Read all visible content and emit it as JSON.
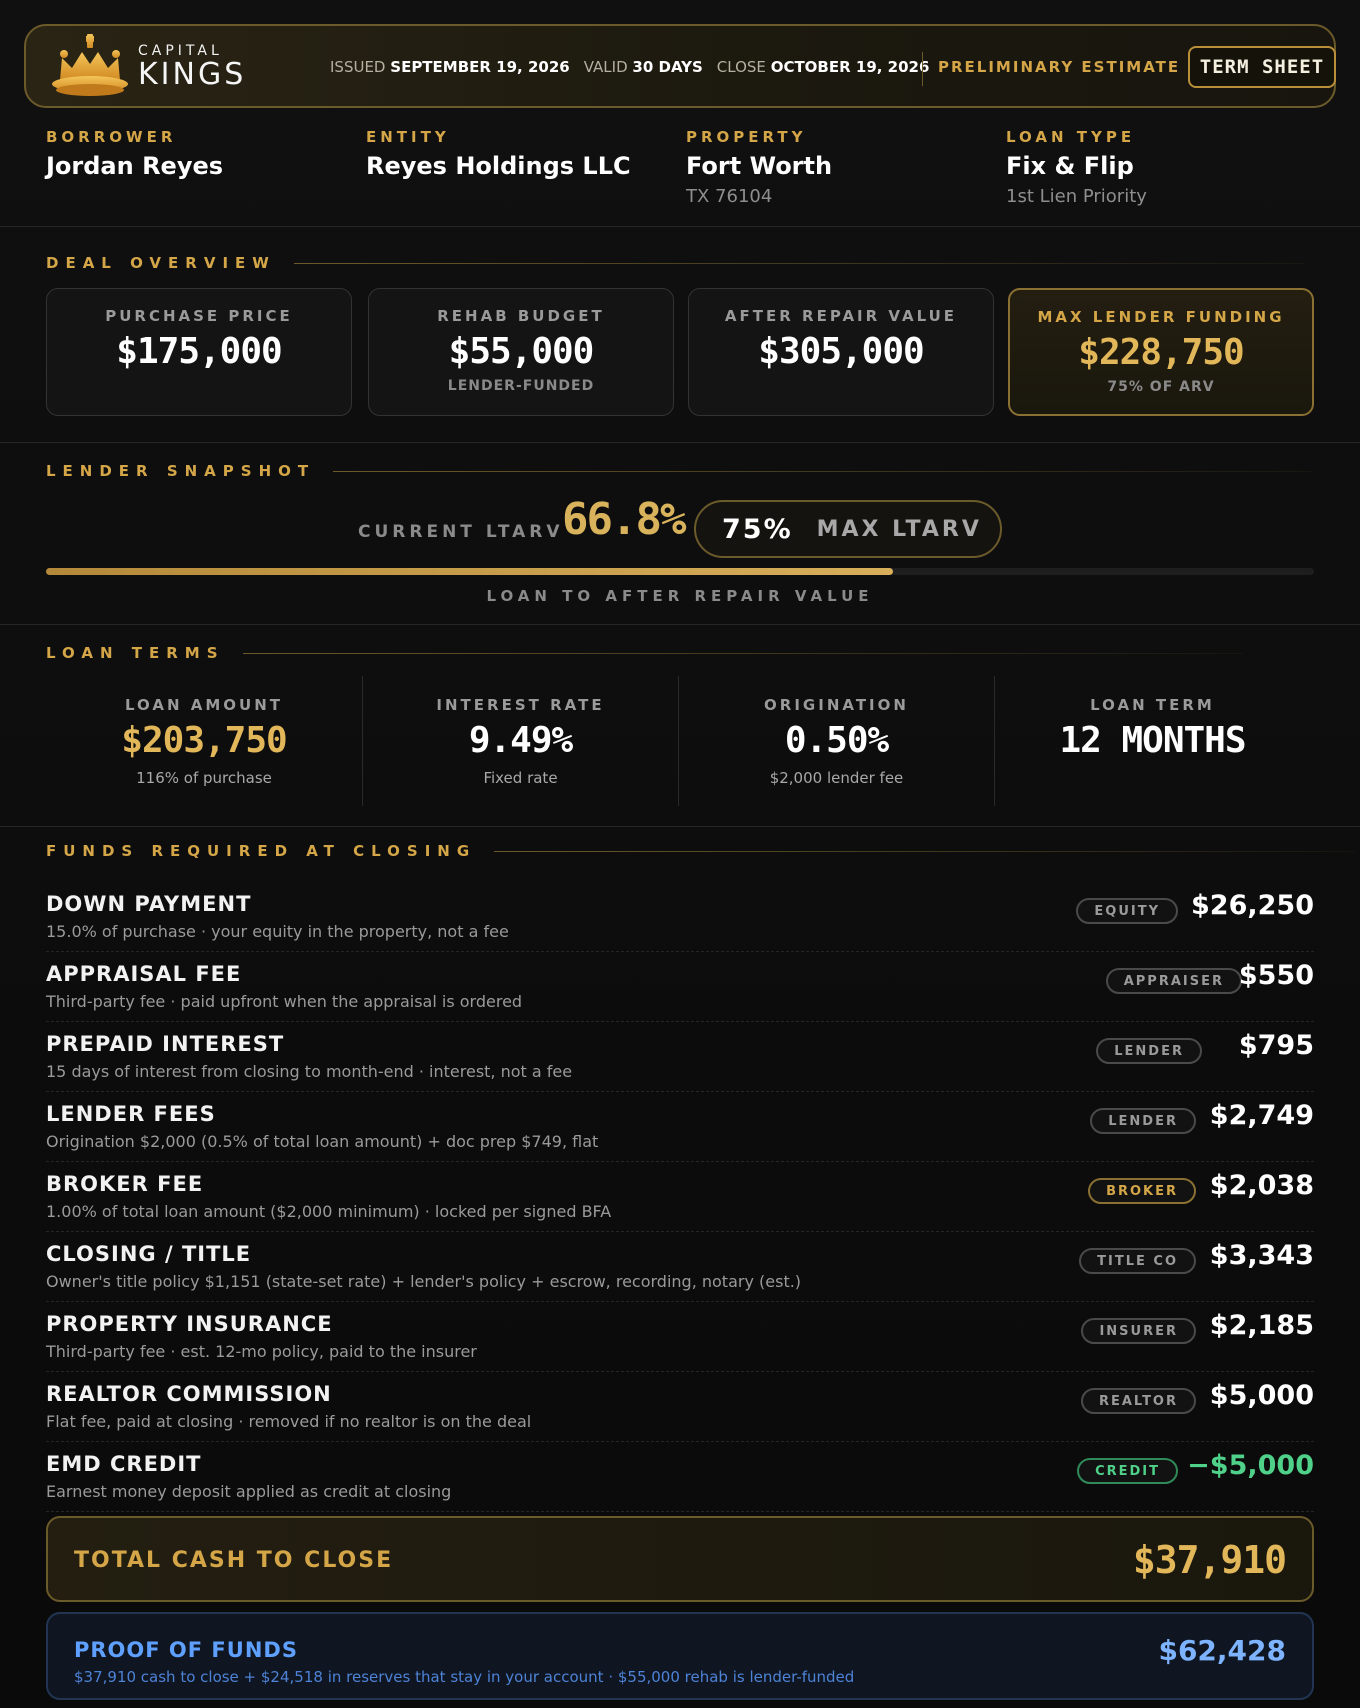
{
  "header": {
    "logo_top": "CAPITAL",
    "logo_bottom": "KINGS",
    "issued_label": "ISSUED",
    "issued_value": "SEPTEMBER 19, 2026",
    "valid_label": "VALID",
    "valid_value": "30 DAYS",
    "close_label": "CLOSE",
    "close_value": "OCTOBER 19, 2026",
    "status": "PRELIMINARY ESTIMATE",
    "term_sheet_button": "TERM SHEET"
  },
  "parties": [
    {
      "label": "BORROWER",
      "value": "Jordan Reyes",
      "sub": ""
    },
    {
      "label": "ENTITY",
      "value": "Reyes Holdings LLC",
      "sub": ""
    },
    {
      "label": "PROPERTY",
      "value": "Fort Worth",
      "sub": "TX 76104"
    },
    {
      "label": "LOAN TYPE",
      "value": "Fix & Flip",
      "sub": "1st Lien Priority"
    }
  ],
  "deal_overview": {
    "title": "DEAL OVERVIEW",
    "cards": [
      {
        "label": "PURCHASE PRICE",
        "value": "$175,000",
        "sub": ""
      },
      {
        "label": "REHAB BUDGET",
        "value": "$55,000",
        "sub": "LENDER-FUNDED"
      },
      {
        "label": "AFTER REPAIR VALUE",
        "value": "$305,000",
        "sub": ""
      },
      {
        "label": "MAX LENDER FUNDING",
        "value": "$228,750",
        "sub": "75% OF ARV"
      }
    ]
  },
  "snapshot": {
    "title": "LENDER SNAPSHOT",
    "current_label": "CURRENT LTARV",
    "current_value": "66.8%",
    "max_pct": "75%",
    "max_label": "MAX LTARV",
    "progress_fraction": 0.668,
    "caption": "LOAN TO AFTER REPAIR VALUE"
  },
  "loan_terms": {
    "title": "LOAN TERMS",
    "items": [
      {
        "label": "LOAN AMOUNT",
        "value": "$203,750",
        "sub": "116% of purchase"
      },
      {
        "label": "INTEREST RATE",
        "value": "9.49%",
        "sub": "Fixed rate"
      },
      {
        "label": "ORIGINATION",
        "value": "0.50%",
        "sub": "$2,000 lender fee"
      },
      {
        "label": "LOAN TERM",
        "value": "12 MONTHS",
        "sub": ""
      }
    ]
  },
  "funds": {
    "title": "FUNDS REQUIRED AT CLOSING",
    "rows": [
      {
        "name": "DOWN PAYMENT",
        "desc": "15.0% of purchase · your equity in the property, not a fee",
        "badge": "EQUITY",
        "amount": "$26,250"
      },
      {
        "name": "APPRAISAL FEE",
        "desc": "Third-party fee · paid upfront when the appraisal is ordered",
        "badge": "APPRAISER",
        "amount": "$550"
      },
      {
        "name": "PREPAID INTEREST",
        "desc": "15 days of interest from closing to month-end · interest, not a fee",
        "badge": "LENDER",
        "amount": "$795"
      },
      {
        "name": "LENDER FEES",
        "desc": "Origination $2,000 (0.5% of total loan amount) + doc prep $749, flat",
        "badge": "LENDER",
        "amount": "$2,749"
      },
      {
        "name": "BROKER FEE",
        "desc": "1.00% of total loan amount ($2,000 minimum) · locked per signed BFA",
        "badge": "BROKER",
        "amount": "$2,038"
      },
      {
        "name": "CLOSING / TITLE",
        "desc": "Owner's title policy $1,151 (state-set rate) + lender's policy + escrow, recording, notary (est.)",
        "badge": "TITLE CO",
        "amount": "$3,343"
      },
      {
        "name": "PROPERTY INSURANCE",
        "desc": "Third-party fee · est. 12-mo policy, paid to the insurer",
        "badge": "INSURER",
        "amount": "$2,185"
      },
      {
        "name": "REALTOR COMMISSION",
        "desc": "Flat fee, paid at closing · removed if no realtor is on the deal",
        "badge": "REALTOR",
        "amount": "$5,000"
      },
      {
        "name": "EMD CREDIT",
        "desc": "Earnest money deposit applied as credit at closing",
        "badge": "CREDIT",
        "amount": "−$5,000"
      }
    ],
    "total_label": "TOTAL CASH TO CLOSE",
    "total_value": "$37,910"
  },
  "proof": {
    "label": "PROOF OF FUNDS",
    "desc": "$37,910 cash to close + $24,518 in reserves that stay in your account · $55,000 rehab is lender-funded",
    "value": "$62,428"
  },
  "colors": {
    "accent_gold": "#d4a648",
    "credit_green": "#4fd18a",
    "proof_blue": "#5fa0ff",
    "background": "#0b0b0b"
  }
}
